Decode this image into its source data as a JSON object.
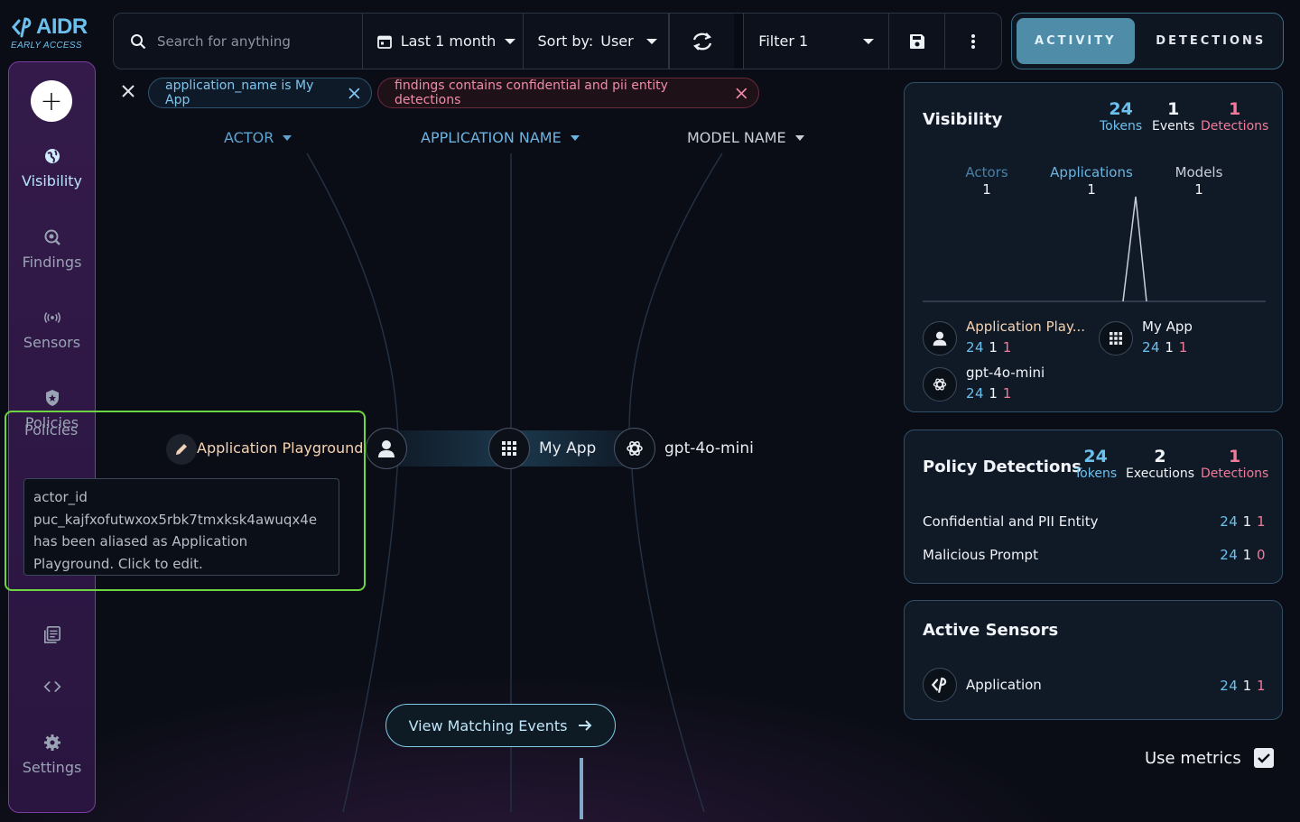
{
  "brand": {
    "name": "AIDR",
    "subtitle": "EARLY ACCESS"
  },
  "sidebar": {
    "items": [
      {
        "label": "Visibility",
        "icon": "globe-icon"
      },
      {
        "label": "Findings",
        "icon": "search-globe-icon"
      },
      {
        "label": "Sensors",
        "icon": "broadcast-icon"
      },
      {
        "label": "Policies",
        "icon": "shield-icon"
      },
      {
        "label": "",
        "icon": "logs-icon"
      },
      {
        "label": "",
        "icon": "code-icon"
      },
      {
        "label": "Settings",
        "icon": "gear-icon"
      }
    ]
  },
  "toolbar": {
    "search_placeholder": "Search for anything",
    "time_range": "Last 1 month",
    "sort_prefix": "Sort by:",
    "sort_value": "User",
    "filter": "Filter 1"
  },
  "mode": {
    "activity": "ACTIVITY",
    "detections": "DETECTIONS"
  },
  "chips": [
    {
      "text": "application_name is My App"
    },
    {
      "text": "findings contains confidential and pii entity detections"
    }
  ],
  "columns": {
    "actor": "ACTOR",
    "application": "APPLICATION NAME",
    "model": "MODEL NAME"
  },
  "graph": {
    "actor_label": "Application Playground",
    "app_label": "My App",
    "model_label": "gpt-4o-mini"
  },
  "tooltip": {
    "text": "actor_id puc_kajfxofutwxox5rbk7tmxksk4awuqx4e has been aliased as Application Playground. Click to edit."
  },
  "visibility": {
    "title": "Visibility",
    "stats": [
      {
        "value": "24",
        "label": "Tokens"
      },
      {
        "value": "1",
        "label": "Events"
      },
      {
        "value": "1",
        "label": "Detections"
      }
    ],
    "columns": [
      {
        "label": "Actors",
        "value": "1"
      },
      {
        "label": "Applications",
        "value": "1"
      },
      {
        "label": "Models",
        "value": "1"
      }
    ],
    "entities": [
      {
        "name": "Application Play...",
        "tokens": "24",
        "events": "1",
        "detections": "1"
      },
      {
        "name": "My App",
        "tokens": "24",
        "events": "1",
        "detections": "1"
      },
      {
        "name": "gpt-4o-mini",
        "tokens": "24",
        "events": "1",
        "detections": "1"
      }
    ]
  },
  "policy": {
    "title": "Policy Detections",
    "stats": [
      {
        "value": "24",
        "label": "Tokens"
      },
      {
        "value": "2",
        "label": "Executions"
      },
      {
        "value": "1",
        "label": "Detections"
      }
    ],
    "rows": [
      {
        "name": "Confidential and PII Entity",
        "tokens": "24",
        "events": "1",
        "detections": "1"
      },
      {
        "name": "Malicious Prompt",
        "tokens": "24",
        "events": "1",
        "detections": "0"
      }
    ]
  },
  "sensors": {
    "title": "Active Sensors",
    "rows": [
      {
        "name": "Application",
        "tokens": "24",
        "events": "1",
        "detections": "1"
      }
    ]
  },
  "cta": {
    "label": "View Matching Events"
  },
  "use_metrics": {
    "label": "Use metrics",
    "checked": true
  }
}
